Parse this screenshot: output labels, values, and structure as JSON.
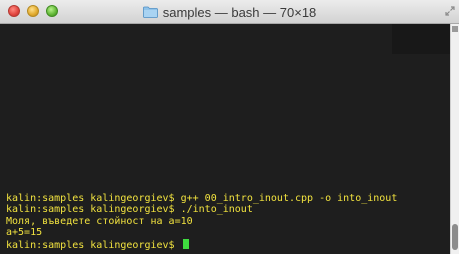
{
  "window": {
    "title": "samples — bash — 70×18"
  },
  "terminal": {
    "lines": [
      "kalin:samples kalingeorgiev$ g++ 00_intro_inout.cpp -o into_inout",
      "kalin:samples kalingeorgiev$ ./into_inout",
      "Моля, въведете стойност на а=10",
      "a+5=15"
    ],
    "prompt": "kalin:samples kalingeorgiev$"
  },
  "colors": {
    "text": "#f2e33f",
    "cursor": "#3fdc3f",
    "background": "#1e1e1e"
  },
  "icons": {
    "close": "close-button",
    "minimize": "minimize-button",
    "zoom": "zoom-button",
    "folder": "folder-icon",
    "fullscreen": "fullscreen-icon"
  }
}
